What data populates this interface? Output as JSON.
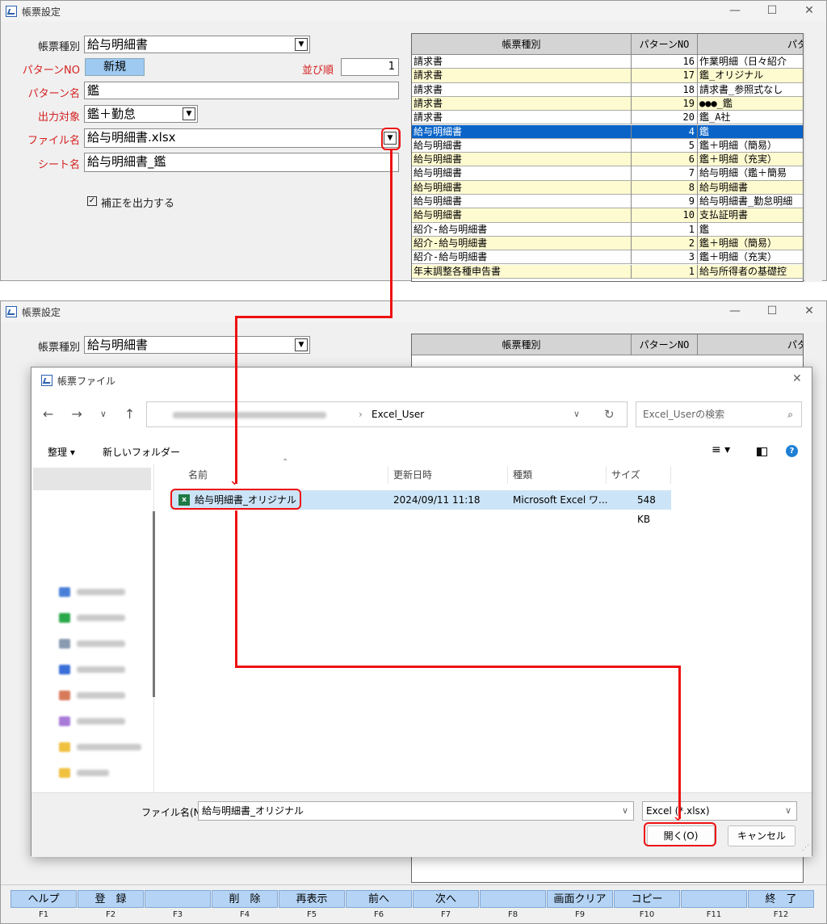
{
  "window": {
    "title": "帳票設定"
  },
  "form": {
    "report_type_label": "帳票種別",
    "report_type_value": "給与明細書",
    "pattern_no_label": "パターンNO",
    "pattern_no_value": "新規",
    "sort_order_label": "並び順",
    "sort_order_value": "1",
    "pattern_name_label": "パターン名",
    "pattern_name_value": "鑑",
    "output_target_label": "出力対象",
    "output_target_value": "鑑＋勤怠",
    "file_name_label": "ファイル名",
    "file_name_value": "給与明細書.xlsx",
    "sheet_name_label": "シート名",
    "sheet_name_value": "給与明細書_鑑",
    "checkbox_label": "補正を出力する"
  },
  "grid": {
    "headers": [
      "帳票種別",
      "パターンNO",
      "パタ"
    ],
    "rows": [
      [
        "請求書",
        "16",
        "作業明細（日々紹介"
      ],
      [
        "請求書",
        "17",
        "鑑_オリジナル"
      ],
      [
        "請求書",
        "18",
        "請求書_参照式なし"
      ],
      [
        "請求書",
        "19",
        "●●●_鑑"
      ],
      [
        "請求書",
        "20",
        "鑑_A社"
      ],
      [
        "給与明細書",
        "4",
        "鑑"
      ],
      [
        "給与明細書",
        "5",
        "鑑＋明細（簡易）"
      ],
      [
        "給与明細書",
        "6",
        "鑑＋明細（充実）"
      ],
      [
        "給与明細書",
        "7",
        "給与明細（鑑＋簡易"
      ],
      [
        "給与明細書",
        "8",
        "給与明細書"
      ],
      [
        "給与明細書",
        "9",
        "給与明細書_勤怠明細"
      ],
      [
        "給与明細書",
        "10",
        "支払証明書"
      ],
      [
        "紹介-給与明細書",
        "1",
        "鑑"
      ],
      [
        "紹介-給与明細書",
        "2",
        "鑑＋明細（簡易）"
      ],
      [
        "紹介-給与明細書",
        "3",
        "鑑＋明細（充実）"
      ],
      [
        "年末調整各種申告書",
        "1",
        "給与所得者の基礎控"
      ]
    ],
    "selected_row": 5
  },
  "dialog": {
    "title": "帳票ファイル",
    "path_current": "Excel_User",
    "search_placeholder": "Excel_Userの検索",
    "organize": "整理 ▾",
    "new_folder": "新しいフォルダー",
    "col_name": "名前",
    "col_date": "更新日時",
    "col_type": "種類",
    "col_size": "サイズ",
    "file": {
      "name": "給与明細書_オリジナル",
      "date": "2024/09/11 11:18",
      "type": "Microsoft Excel ワ...",
      "size": "548 KB"
    },
    "filename_label": "ファイル名(N):",
    "filename_value": "給与明細書_オリジナル",
    "filter_value": "Excel (*.xlsx)",
    "open_button": "開く(O)",
    "cancel_button": "キャンセル"
  },
  "fkeys": [
    {
      "label": "ヘルプ",
      "key": "F1"
    },
    {
      "label": "登　録",
      "key": "F2"
    },
    {
      "label": "",
      "key": "F3"
    },
    {
      "label": "削　除",
      "key": "F4"
    },
    {
      "label": "再表示",
      "key": "F5"
    },
    {
      "label": "前へ",
      "key": "F6"
    },
    {
      "label": "次へ",
      "key": "F7"
    },
    {
      "label": "",
      "key": "F8"
    },
    {
      "label": "画面クリア",
      "key": "F9"
    },
    {
      "label": "コピー",
      "key": "F10"
    },
    {
      "label": "",
      "key": "F11"
    },
    {
      "label": "終　了",
      "key": "F12"
    }
  ],
  "colors": {
    "selection": "#0a64c8",
    "highlight": "#e11111",
    "fkey": "#b5d4f5"
  }
}
